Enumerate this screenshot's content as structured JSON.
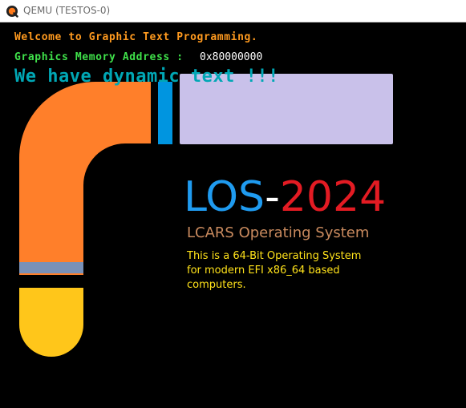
{
  "window": {
    "title": "QEMU (TESTOS-0)",
    "app_icon": "qemu-icon"
  },
  "screen": {
    "welcome_text": "Welcome to Graphic Text Programming.",
    "memory_label": "Graphics Memory Address : ",
    "memory_value": "0x80000000",
    "dynamic_text": "We have dynamic text !!!",
    "logo": {
      "los": "LOS",
      "dash": "-",
      "year": "2024"
    },
    "subtitle": "LCARS Operating System",
    "description_lines": [
      "This is a 64-Bit Operating System",
      "for modern EFI x86_64 based",
      "computers."
    ]
  },
  "colors": {
    "lcars_orange": "#ff7f2a",
    "lcars_blue": "#0095e0",
    "lcars_lavender": "#c9c1ea",
    "lcars_slate": "#7991b8",
    "lcars_yellow": "#ffc61a",
    "welcome_text": "#ff9a1f",
    "address_text": "#3fe04a",
    "dynamic_text": "#00a7b5",
    "logo_blue": "#1f9bf0",
    "logo_red": "#e31b23",
    "subtitle": "#c98a5e",
    "description": "#ffe21a"
  }
}
